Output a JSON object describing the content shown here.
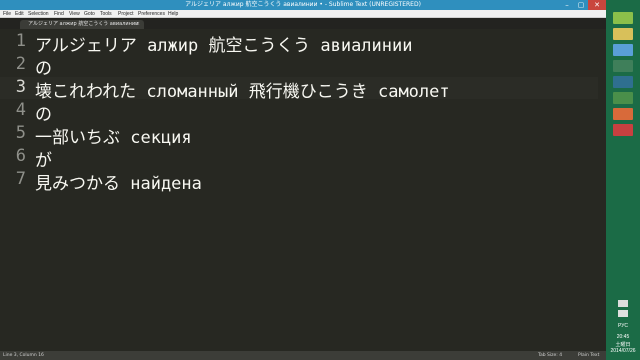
{
  "window": {
    "title": "アルジェリア алжир 航空こうくう авиалинии • - Sublime Text (UNREGISTERED)",
    "minimize_glyph": "–",
    "maximize_glyph": "▢",
    "close_glyph": "✕"
  },
  "menu": [
    "File",
    "Edit",
    "Selection",
    "Find",
    "View",
    "Goto",
    "Tools",
    "Project",
    "Preferences",
    "Help"
  ],
  "tab": {
    "label": "アルジェリア алжир 航空こうくう авиалинии",
    "close_glyph": "×"
  },
  "editor": {
    "lines": [
      {
        "number": "1",
        "text": "アルジェリア алжир 航空こうくう авиалинии"
      },
      {
        "number": "2",
        "text": "の"
      },
      {
        "number": "3",
        "text": "壊これわれた сломанный 飛行機ひこうき самолет"
      },
      {
        "number": "4",
        "text": "の"
      },
      {
        "number": "5",
        "text": "一部いちぶ секция"
      },
      {
        "number": "6",
        "text": "が"
      },
      {
        "number": "7",
        "text": "見みつかる найдена"
      }
    ],
    "active_line": 3
  },
  "status": {
    "position": "Line 3, Column 16",
    "tab_size": "Tab Size: 4",
    "syntax": "Plain Text"
  },
  "taskbar": {
    "language": "РУС",
    "time": "20:45",
    "weekday": "土曜日",
    "date": "2014/07/26",
    "icons": [
      "app-icon-1",
      "app-icon-2",
      "app-icon-3",
      "app-icon-4",
      "app-icon-5",
      "app-icon-6",
      "app-icon-7",
      "app-icon-8"
    ]
  },
  "colors": {
    "editor_bg": "#272822",
    "text": "#f8f8f2",
    "line_number": "#8f908a",
    "titlebar": "#2f8fbe",
    "taskbar": "#1b6b46"
  }
}
